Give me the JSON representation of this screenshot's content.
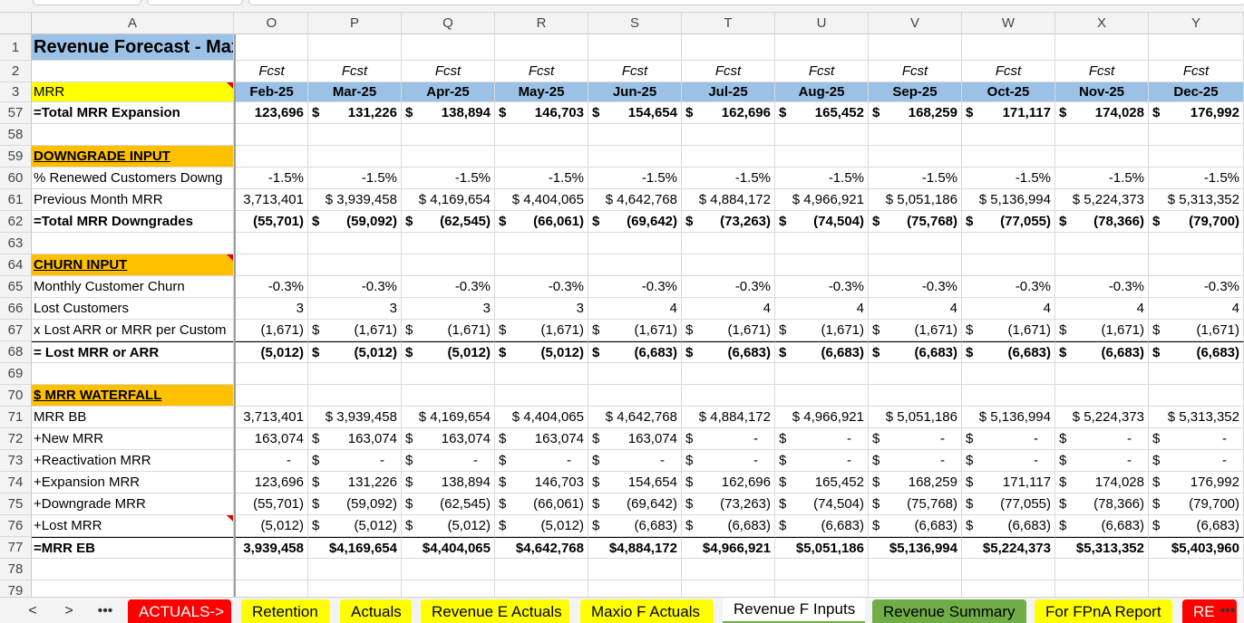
{
  "columns": [
    "A",
    "O",
    "P",
    "Q",
    "R",
    "S",
    "T",
    "U",
    "V",
    "W",
    "X",
    "Y"
  ],
  "title": "Revenue Forecast - Max",
  "fcst": "Fcst",
  "mrr_label": "MRR",
  "months": [
    "Feb-25",
    "Mar-25",
    "Apr-25",
    "May-25",
    "Jun-25",
    "Jul-25",
    "Aug-25",
    "Sep-25",
    "Oct-25",
    "Nov-25",
    "Dec-25"
  ],
  "rows": [
    {
      "n": "57",
      "label": "=Total MRR Expansion",
      "bold": true,
      "vals": [
        "123,696",
        "131,226",
        "138,894",
        "146,703",
        "154,654",
        "162,696",
        "165,452",
        "168,259",
        "171,117",
        "174,028",
        "176,992"
      ],
      "dollar_from": 1
    },
    {
      "n": "58",
      "label": "",
      "vals": []
    },
    {
      "n": "59",
      "label": "DOWNGRADE INPUT",
      "section": true,
      "vals": []
    },
    {
      "n": "60",
      "label": "% Renewed Customers Downg",
      "vals": [
        "-1.5%",
        "-1.5%",
        "-1.5%",
        "-1.5%",
        "-1.5%",
        "-1.5%",
        "-1.5%",
        "-1.5%",
        "-1.5%",
        "-1.5%",
        "-1.5%"
      ],
      "dollar_from": 99
    },
    {
      "n": "61",
      "label": "Previous Month MRR",
      "vals": [
        "3,713,401",
        "$ 3,939,458",
        "$ 4,169,654",
        "$ 4,404,065",
        "$ 4,642,768",
        "$ 4,884,172",
        "$ 4,966,921",
        "$ 5,051,186",
        "$ 5,136,994",
        "$ 5,224,373",
        "$ 5,313,352"
      ],
      "dollar_from": 99
    },
    {
      "n": "62",
      "label": "=Total MRR Downgrades",
      "bold": true,
      "vals": [
        "(55,701)",
        "(59,092)",
        "(62,545)",
        "(66,061)",
        "(69,642)",
        "(73,263)",
        "(74,504)",
        "(75,768)",
        "(77,055)",
        "(78,366)",
        "(79,700)"
      ],
      "dollar_from": 1
    },
    {
      "n": "63",
      "label": "",
      "vals": []
    },
    {
      "n": "64",
      "label": "CHURN INPUT",
      "section": true,
      "vals": []
    },
    {
      "n": "65",
      "label": "Monthly Customer Churn",
      "vals": [
        "-0.3%",
        "-0.3%",
        "-0.3%",
        "-0.3%",
        "-0.3%",
        "-0.3%",
        "-0.3%",
        "-0.3%",
        "-0.3%",
        "-0.3%",
        "-0.3%"
      ],
      "dollar_from": 99
    },
    {
      "n": "66",
      "label": "Lost Customers",
      "vals": [
        "3",
        "3",
        "3",
        "3",
        "4",
        "4",
        "4",
        "4",
        "4",
        "4",
        "4"
      ],
      "dollar_from": 99
    },
    {
      "n": "67",
      "label": "x Lost ARR or MRR per Custom",
      "vals": [
        "(1,671)",
        "(1,671)",
        "(1,671)",
        "(1,671)",
        "(1,671)",
        "(1,671)",
        "(1,671)",
        "(1,671)",
        "(1,671)",
        "(1,671)",
        "(1,671)"
      ],
      "dollar_from": 1
    },
    {
      "n": "68",
      "label": "= Lost MRR or ARR",
      "bold": true,
      "topline": true,
      "vals": [
        "(5,012)",
        "(5,012)",
        "(5,012)",
        "(5,012)",
        "(6,683)",
        "(6,683)",
        "(6,683)",
        "(6,683)",
        "(6,683)",
        "(6,683)",
        "(6,683)"
      ],
      "dollar_from": 1
    },
    {
      "n": "69",
      "label": "",
      "vals": []
    },
    {
      "n": "70",
      "label": "$ MRR WATERFALL",
      "section": true,
      "vals": []
    },
    {
      "n": "71",
      "label": "MRR BB",
      "vals": [
        "3,713,401",
        "$ 3,939,458",
        "$ 4,169,654",
        "$ 4,404,065",
        "$ 4,642,768",
        "$ 4,884,172",
        "$ 4,966,921",
        "$ 5,051,186",
        "$ 5,136,994",
        "$ 5,224,373",
        "$ 5,313,352"
      ],
      "dollar_from": 99
    },
    {
      "n": "72",
      "label": "+New MRR",
      "vals": [
        "163,074",
        "163,074",
        "163,074",
        "163,074",
        "163,074",
        "-",
        "-",
        "-",
        "-",
        "-",
        "-"
      ],
      "dollar_from": 1
    },
    {
      "n": "73",
      "label": "+Reactivation MRR",
      "vals": [
        "-",
        "-",
        "-",
        "-",
        "-",
        "-",
        "-",
        "-",
        "-",
        "-",
        "-"
      ],
      "dollar_from": 1
    },
    {
      "n": "74",
      "label": "+Expansion MRR",
      "vals": [
        "123,696",
        "131,226",
        "138,894",
        "146,703",
        "154,654",
        "162,696",
        "165,452",
        "168,259",
        "171,117",
        "174,028",
        "176,992"
      ],
      "dollar_from": 1
    },
    {
      "n": "75",
      "label": "+Downgrade MRR",
      "vals": [
        "(55,701)",
        "(59,092)",
        "(62,545)",
        "(66,061)",
        "(69,642)",
        "(73,263)",
        "(74,504)",
        "(75,768)",
        "(77,055)",
        "(78,366)",
        "(79,700)"
      ],
      "dollar_from": 1
    },
    {
      "n": "76",
      "label": "+Lost MRR",
      "flag": true,
      "vals": [
        "(5,012)",
        "(5,012)",
        "(5,012)",
        "(5,012)",
        "(6,683)",
        "(6,683)",
        "(6,683)",
        "(6,683)",
        "(6,683)",
        "(6,683)",
        "(6,683)"
      ],
      "dollar_from": 1
    },
    {
      "n": "77",
      "label": "=MRR EB",
      "bold": true,
      "topline": true,
      "vals": [
        "3,939,458",
        "$4,169,654",
        "$4,404,065",
        "$4,642,768",
        "$4,884,172",
        "$4,966,921",
        "$5,051,186",
        "$5,136,994",
        "$5,224,373",
        "$5,313,352",
        "$5,403,960"
      ],
      "dollar_from": 99
    },
    {
      "n": "78",
      "label": "",
      "vals": []
    },
    {
      "n": "79",
      "label": "",
      "vals": []
    }
  ],
  "nav": {
    "prev": "<",
    "next": ">",
    "more": "•••",
    "more_right": "•••"
  },
  "tabs": [
    {
      "label": "ACTUALS->",
      "style": "red"
    },
    {
      "label": "Retention",
      "style": "yellow"
    },
    {
      "label": "Actuals",
      "style": "yellow"
    },
    {
      "label": "Revenue E Actuals",
      "style": "yellow"
    },
    {
      "label": "Maxio F Actuals",
      "style": "yellow"
    },
    {
      "label": "Revenue F Inputs",
      "style": "active"
    },
    {
      "label": "Revenue Summary",
      "style": "green"
    },
    {
      "label": "For FPnA Report",
      "style": "yellow"
    },
    {
      "label": "RE",
      "style": "red"
    }
  ]
}
